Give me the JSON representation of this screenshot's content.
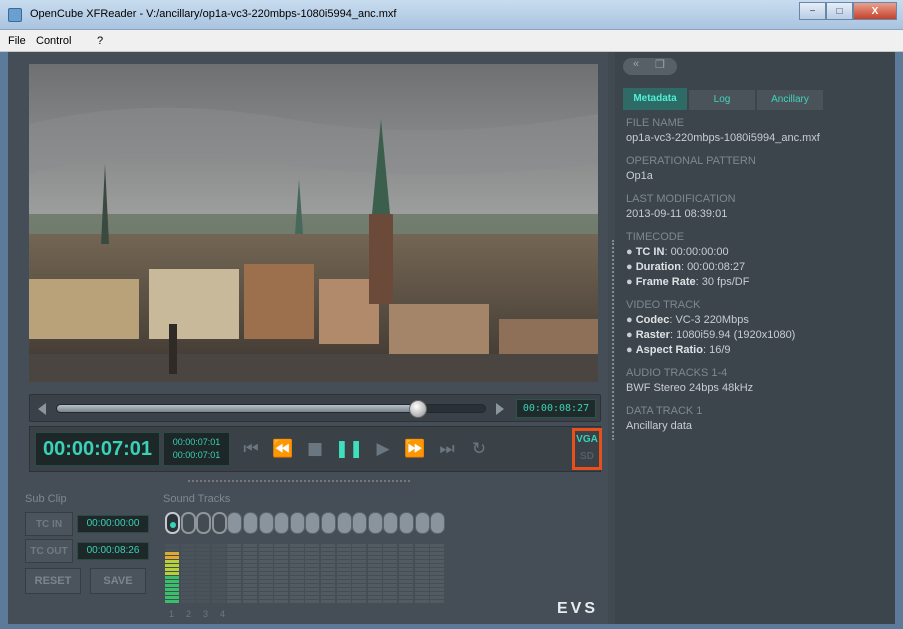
{
  "window": {
    "title": "OpenCube XFReader - V:/ancillary/op1a-vc3-220mbps-1080i5994_anc.mxf",
    "minimize": "−",
    "maximize": "□",
    "close": "X"
  },
  "menu": [
    "File",
    "Control",
    "?"
  ],
  "player": {
    "scrub_time": "00:00:08:27",
    "scrub_position": 0.84,
    "timecode_main": "00:00:07:01",
    "timecode_small_1": "00:00:07:01",
    "timecode_small_2": "00:00:07:01",
    "vga_label": "VGA",
    "sd_label": "SD"
  },
  "subclip": {
    "label": "Sub Clip",
    "tc_in_label": "TC IN",
    "tc_in_value": "00:00:00:00",
    "tc_out_label": "TC OUT",
    "tc_out_value": "00:00:08:26",
    "reset_label": "RESET",
    "save_label": "SAVE"
  },
  "sound_tracks": {
    "label": "Sound Tracks",
    "numbers": [
      "1",
      "2",
      "3",
      "4"
    ]
  },
  "brand": "EVS",
  "panel": {
    "nav_back": "«",
    "nav_other": "❐",
    "tabs": [
      "Metadata",
      "Log",
      "Ancillary"
    ],
    "active_tab": "Metadata"
  },
  "metadata": {
    "file_name_head": "FILE NAME",
    "file_name": "op1a-vc3-220mbps-1080i5994_anc.mxf",
    "op_head": "OPERATIONAL PATTERN",
    "op": "Op1a",
    "lastmod_head": "LAST MODIFICATION",
    "lastmod": "2013-09-11 08:39:01",
    "tc_head": "TIMECODE",
    "tc_in_label": "TC IN",
    "tc_in": "00:00:00:00",
    "duration_label": "Duration",
    "duration": "00:00:08:27",
    "frame_rate_label": "Frame Rate",
    "frame_rate": "30 fps/DF",
    "video_head": "VIDEO TRACK",
    "codec_label": "Codec",
    "codec": "VC-3 220Mbps",
    "raster_label": "Raster",
    "raster": "1080i59.94 (1920x1080)",
    "aspect_label": "Aspect Ratio",
    "aspect": "16/9",
    "audio_head": "AUDIO TRACKS 1-4",
    "audio": "BWF Stereo 24bps 48kHz",
    "data_head": "DATA TRACK 1",
    "data": "Ancillary data"
  }
}
